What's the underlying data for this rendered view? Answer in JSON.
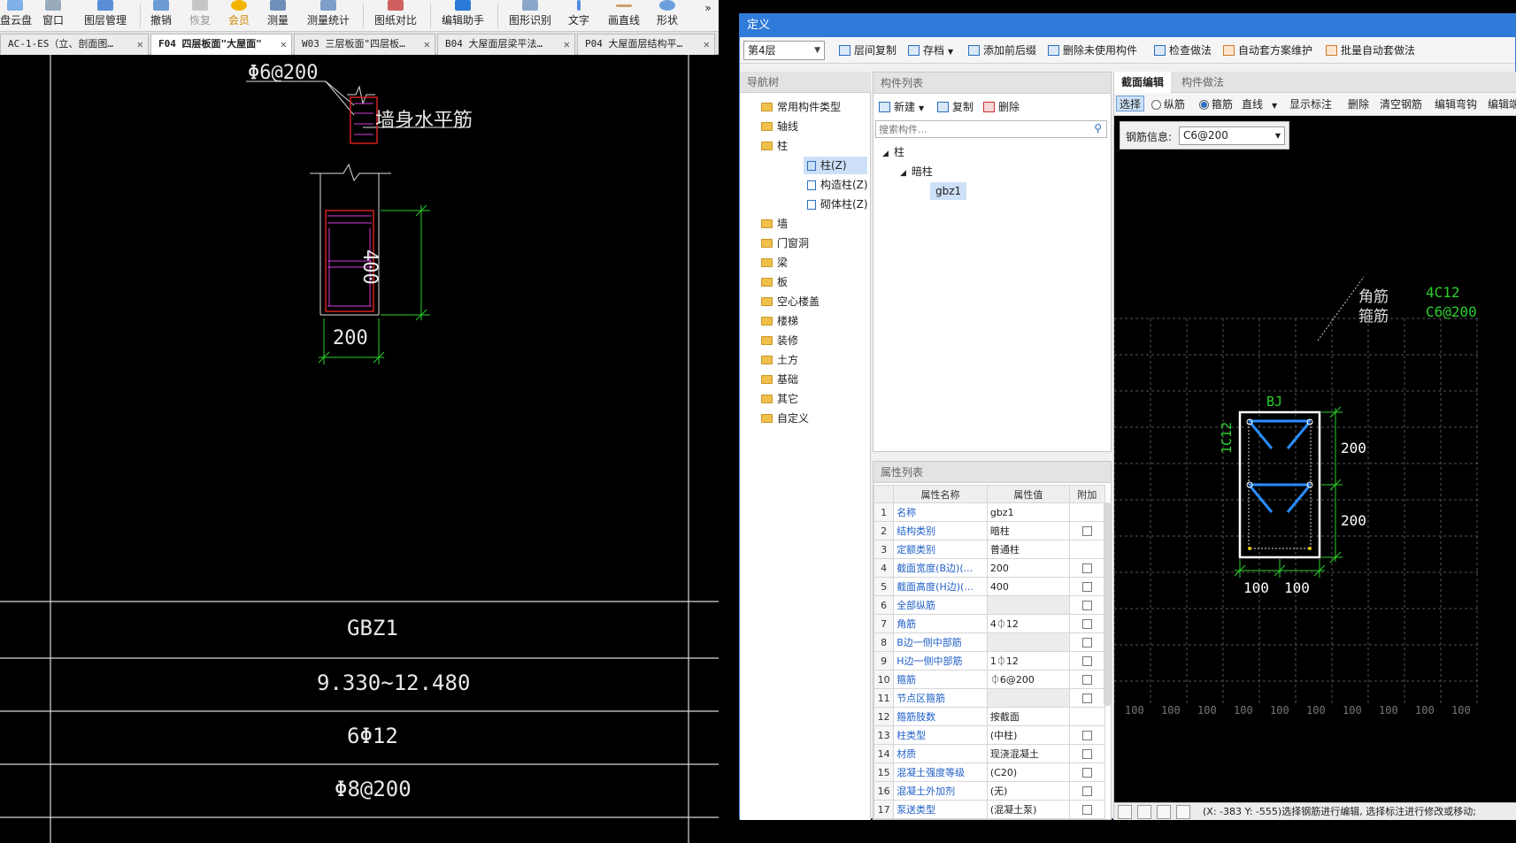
{
  "main_toolbar": {
    "items": [
      "盘云盘",
      "窗口",
      "图层管理",
      "撤销",
      "恢复",
      "会员",
      "测量",
      "测量统计",
      "图纸对比",
      "编辑助手",
      "图形识别",
      "文字",
      "画直线",
      "形状"
    ],
    "overflow": "»"
  },
  "doc_tabs": [
    "AC-1-ES（立、剖面图…",
    "F04 四层板面\"大屋面\"",
    "W03 三层板面\"四层板…",
    "B04 大屋面层梁平法…",
    "P04 大屋面层结构平…"
  ],
  "cad": {
    "rebar_label": "Φ6@200",
    "wall_label": "墙身水平筋",
    "dim_height": "400",
    "dim_width": "200",
    "table_rows": [
      "GBZ1",
      "9.330~12.480",
      "6Φ12",
      "Φ8@200"
    ]
  },
  "dialog": {
    "title": "定义",
    "floor": "第4层",
    "toolbar": [
      "层间复制",
      "存档",
      "添加前后缀",
      "删除未使用构件",
      "检查做法",
      "自动套方案维护",
      "批量自动套做法"
    ],
    "nav": {
      "header": "导航树",
      "strip_labels": [
        "第",
        "导"
      ],
      "items": [
        "常用构件类型",
        "轴线",
        "柱",
        "墙",
        "门窗洞",
        "梁",
        "板",
        "空心楼盖",
        "楼梯",
        "装修",
        "土方",
        "基础",
        "其它",
        "自定义"
      ],
      "sub_items": [
        "柱(Z)",
        "构造柱(Z)",
        "砌体柱(Z)"
      ]
    },
    "components": {
      "header": "构件列表",
      "buttons": [
        "新建",
        "复制",
        "删除"
      ],
      "search_placeholder": "搜索构件...",
      "tree": [
        "柱",
        "暗柱",
        "gbz1"
      ]
    },
    "properties": {
      "header": "属性列表",
      "columns": [
        "属性名称",
        "属性值",
        "附加"
      ],
      "rows": [
        {
          "n": "1",
          "name": "名称",
          "value": "gbz1"
        },
        {
          "n": "2",
          "name": "结构类别",
          "value": "暗柱"
        },
        {
          "n": "3",
          "name": "定额类别",
          "value": "普通柱"
        },
        {
          "n": "4",
          "name": "截面宽度(B边)(...",
          "value": "200"
        },
        {
          "n": "5",
          "name": "截面高度(H边)(...",
          "value": "400"
        },
        {
          "n": "6",
          "name": "全部纵筋",
          "value": ""
        },
        {
          "n": "7",
          "name": "角筋",
          "value": "4⏀12"
        },
        {
          "n": "8",
          "name": "B边一侧中部筋",
          "value": ""
        },
        {
          "n": "9",
          "name": "H边一侧中部筋",
          "value": "1⏀12"
        },
        {
          "n": "10",
          "name": "箍筋",
          "value": "⏀6@200"
        },
        {
          "n": "11",
          "name": "节点区箍筋",
          "value": ""
        },
        {
          "n": "12",
          "name": "箍筋肢数",
          "value": "按截面"
        },
        {
          "n": "13",
          "name": "柱类型",
          "value": "(中柱)"
        },
        {
          "n": "14",
          "name": "材质",
          "value": "现浇混凝土"
        },
        {
          "n": "15",
          "name": "混凝土强度等级",
          "value": "(C20)"
        },
        {
          "n": "16",
          "name": "混凝土外加剂",
          "value": "(无)"
        },
        {
          "n": "17",
          "name": "泵送类型",
          "value": "(混凝土泵)"
        }
      ]
    },
    "section": {
      "tabs": [
        "截面编辑",
        "构件做法"
      ],
      "toolbar": [
        "选择",
        "纵筋",
        "箍筋",
        "直线",
        "显示标注",
        "删除",
        "清空钢筋",
        "编辑弯钩",
        "编辑端"
      ],
      "rebar_info_label": "钢筋信息:",
      "rebar_info_value": "C6@200",
      "legend_corner": "角筋",
      "legend_stirrup": "箍筋",
      "legend_corner_val": "4C12",
      "legend_stirrup_val": "C6@200",
      "bj": "BJ",
      "side_label": "1C12",
      "dim_top": "200",
      "dim_bottom": "200",
      "dim_left": "100",
      "dim_right": "100",
      "grid_labels": [
        "100",
        "100",
        "100",
        "100",
        "100",
        "100",
        "100",
        "100",
        "100",
        "100"
      ],
      "status": "(X: -383 Y: -555)选择钢筋进行编辑, 选择标注进行修改或移动;"
    }
  },
  "colors": {
    "dialog_title": "#2f7bd9",
    "rebar_blue": "#2a8cff",
    "cad_green": "#2bd02b",
    "cad_magenta": "#d63bd6",
    "cad_red": "#d42020"
  }
}
